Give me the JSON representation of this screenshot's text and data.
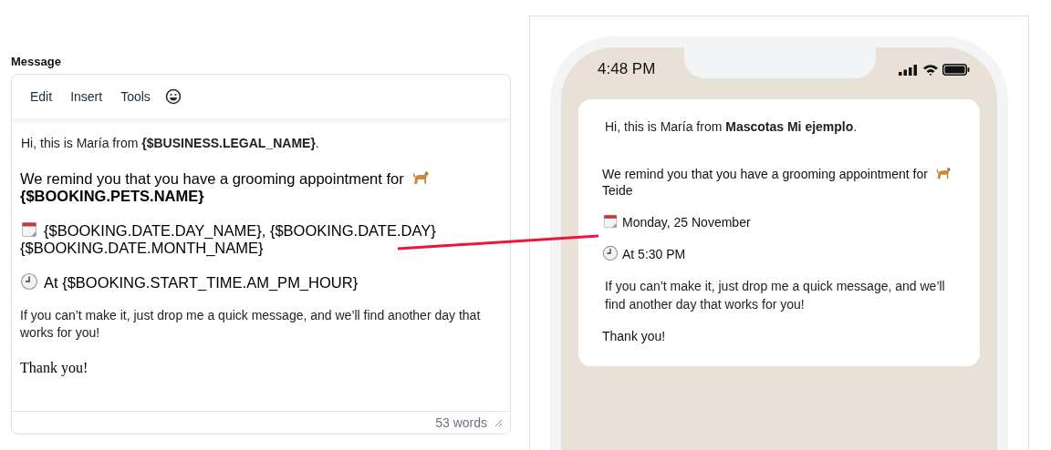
{
  "editor": {
    "label": "Message",
    "menu": [
      {
        "label": "Edit"
      },
      {
        "label": "Insert"
      },
      {
        "label": "Tools"
      }
    ],
    "paragraphs": [
      {
        "kind": "small",
        "parts": [
          {
            "kind": "text",
            "text": "Hi, this is María from  **{$BUSINESS.LEGAL_NAME}**."
          }
        ]
      },
      {
        "kind": "large",
        "parts": [
          {
            "kind": "text",
            "text": "We remind you that you have a grooming appointment for "
          },
          {
            "kind": "dog"
          },
          {
            "kind": "text",
            "text": "**{$BOOKING.PETS.NAME}**"
          }
        ]
      },
      {
        "kind": "large",
        "parts": [
          {
            "kind": "calendar"
          },
          {
            "kind": "text",
            "text": "{$BOOKING.DATE.DAY_NAME}, {$BOOKING.DATE.DAY}"
          },
          {
            "kind": "text",
            "text": "{$BOOKING.DATE.MONTH_NAME}"
          }
        ]
      },
      {
        "kind": "large",
        "parts": [
          {
            "kind": "clock"
          },
          {
            "kind": "text",
            "text": "At {$BOOKING.START_TIME.AM_PM_HOUR}"
          }
        ]
      },
      {
        "kind": "small",
        "parts": [
          {
            "kind": "text",
            "text": "If you can’t make it, just drop me a quick message, and we’ll find another day that works for you!"
          }
        ]
      },
      {
        "kind": "serif",
        "parts": [
          {
            "kind": "text",
            "text": "Thank you!"
          }
        ]
      }
    ],
    "word_count": "53 words"
  },
  "preview": {
    "time": "4:48 PM",
    "paragraphs": [
      {
        "kind": "small",
        "parts": [
          {
            "kind": "text",
            "text": "Hi, this is María from  **Mascotas Mi ejemplo**."
          }
        ]
      },
      {
        "kind": "plain",
        "parts": [
          {
            "kind": "text",
            "text": "We remind you that you have a grooming appointment for"
          },
          {
            "kind": "dog"
          },
          {
            "kind": "text",
            "text": "Teide"
          }
        ]
      },
      {
        "kind": "plain",
        "parts": [
          {
            "kind": "calendar"
          },
          {
            "kind": "text",
            "text": "Monday, 25 November"
          }
        ]
      },
      {
        "kind": "plain",
        "parts": [
          {
            "kind": "clock"
          },
          {
            "kind": "text",
            "text": "At 5:30 PM"
          }
        ]
      },
      {
        "kind": "small",
        "parts": [
          {
            "kind": "text",
            "text": "If you can’t make it, just drop me a quick message, and we’ll find another day that works for you!"
          }
        ]
      },
      {
        "kind": "plain",
        "parts": [
          {
            "kind": "text",
            "text": "Thank you!"
          }
        ]
      }
    ]
  }
}
